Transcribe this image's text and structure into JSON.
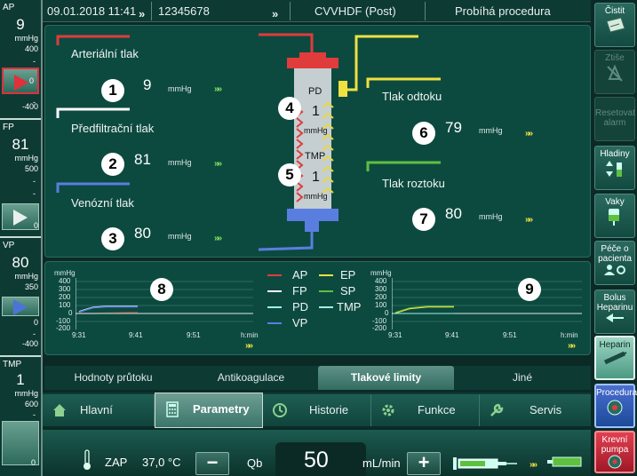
{
  "left_panel": {
    "ap": {
      "label": "AP",
      "value": "9",
      "unit": "mmHg",
      "max": "400",
      "mid": "0",
      "min": "-400",
      "dash": "-"
    },
    "fp": {
      "label": "FP",
      "value": "81",
      "unit": "mmHg",
      "max": "500",
      "mid": "0",
      "dash": "-"
    },
    "vp": {
      "label": "VP",
      "value": "80",
      "unit": "mmHg",
      "max": "350",
      "mid": "0",
      "min": "-400",
      "dash": "-"
    },
    "tmp": {
      "label": "TMP",
      "value": "1",
      "unit": "mmHg",
      "max": "600",
      "mid": "0",
      "dash": "-"
    }
  },
  "header": {
    "datetime": "09.01.2018 11:41",
    "patient_id": "12345678",
    "mode": "CVVHDF (Post)",
    "status": "Probíhá procedura",
    "chevrons": "»"
  },
  "pressures": {
    "arterial": {
      "label": "Arteriální tlak",
      "value": "9",
      "unit": "mmHg",
      "badge": "1"
    },
    "prefilter": {
      "label": "Předfiltrační tlak",
      "value": "81",
      "unit": "mmHg",
      "badge": "2"
    },
    "venous": {
      "label": "Venózní tlak",
      "value": "80",
      "unit": "mmHg",
      "badge": "3"
    },
    "pd": {
      "label": "PD",
      "value": "1",
      "unit": "mmHg",
      "badge": "4"
    },
    "tmp": {
      "label": "TMP",
      "value": "1",
      "unit": "mmHg",
      "badge": "5"
    },
    "effluent": {
      "label": "Tlak odtoku",
      "value": "79",
      "unit": "mmHg",
      "badge": "6"
    },
    "dialysate": {
      "label": "Tlak roztoku",
      "value": "80",
      "unit": "mmHg",
      "badge": "7"
    }
  },
  "trends": {
    "left": {
      "unit": "mmHg",
      "yticks": [
        "400",
        "300",
        "200",
        "100",
        "0",
        "-100",
        "-200"
      ],
      "xticks": [
        "9:31",
        "9:41",
        "9:51"
      ],
      "xunit": "h:min",
      "badge": "8"
    },
    "right": {
      "unit": "mmHg",
      "yticks": [
        "400",
        "300",
        "200",
        "100",
        "0",
        "-100",
        "-200"
      ],
      "xticks": [
        "9:31",
        "9:41",
        "9:51"
      ],
      "xunit": "h:min",
      "badge": "9"
    },
    "legend": [
      {
        "name": "AP",
        "color": "#e03c3c"
      },
      {
        "name": "EP",
        "color": "#f0e040"
      },
      {
        "name": "FP",
        "color": "#ffffff"
      },
      {
        "name": "SP",
        "color": "#5fc040"
      },
      {
        "name": "PD",
        "color": "#9ff0e8"
      },
      {
        "name": "TMP",
        "color": "#9ff0e8"
      },
      {
        "name": "VP",
        "color": "#5a7ee0"
      }
    ]
  },
  "subtabs": [
    "Hodnoty průtoku",
    "Antikoagulace",
    "Tlakové limity",
    "Jiné"
  ],
  "maintabs": [
    "Hlavní",
    "Parametry",
    "Historie",
    "Funkce",
    "Servis"
  ],
  "bottom": {
    "zap_label": "ZAP",
    "temperature": "37,0 °C",
    "qb_label": "Qb",
    "qb_value": "50",
    "qb_unit": "mL/min",
    "minus": "−",
    "plus": "+"
  },
  "right_buttons": [
    {
      "label": "Čistit",
      "state": "enabled"
    },
    {
      "label": "Ztiše",
      "state": "disabled"
    },
    {
      "label": "Resetovat alarm",
      "state": "disabled"
    },
    {
      "label": "Hladiny",
      "state": "enabled"
    },
    {
      "label": "Vaky",
      "state": "enabled"
    },
    {
      "label": "Péče o pacienta",
      "state": "enabled"
    },
    {
      "label": "Bolus Heparinu",
      "state": "enabled"
    },
    {
      "label": "Heparin",
      "state": "highlighted"
    },
    {
      "label": "Procedura",
      "state": "active"
    },
    {
      "label": "Krevní pumpa",
      "state": "alarm"
    }
  ],
  "colors": {
    "panel": "#0c4a40",
    "arterial": "#e03c3c",
    "venous": "#5a7ee0",
    "effluent": "#f0e040",
    "dialysate": "#5fc040",
    "chevron": "#7fe05a"
  }
}
